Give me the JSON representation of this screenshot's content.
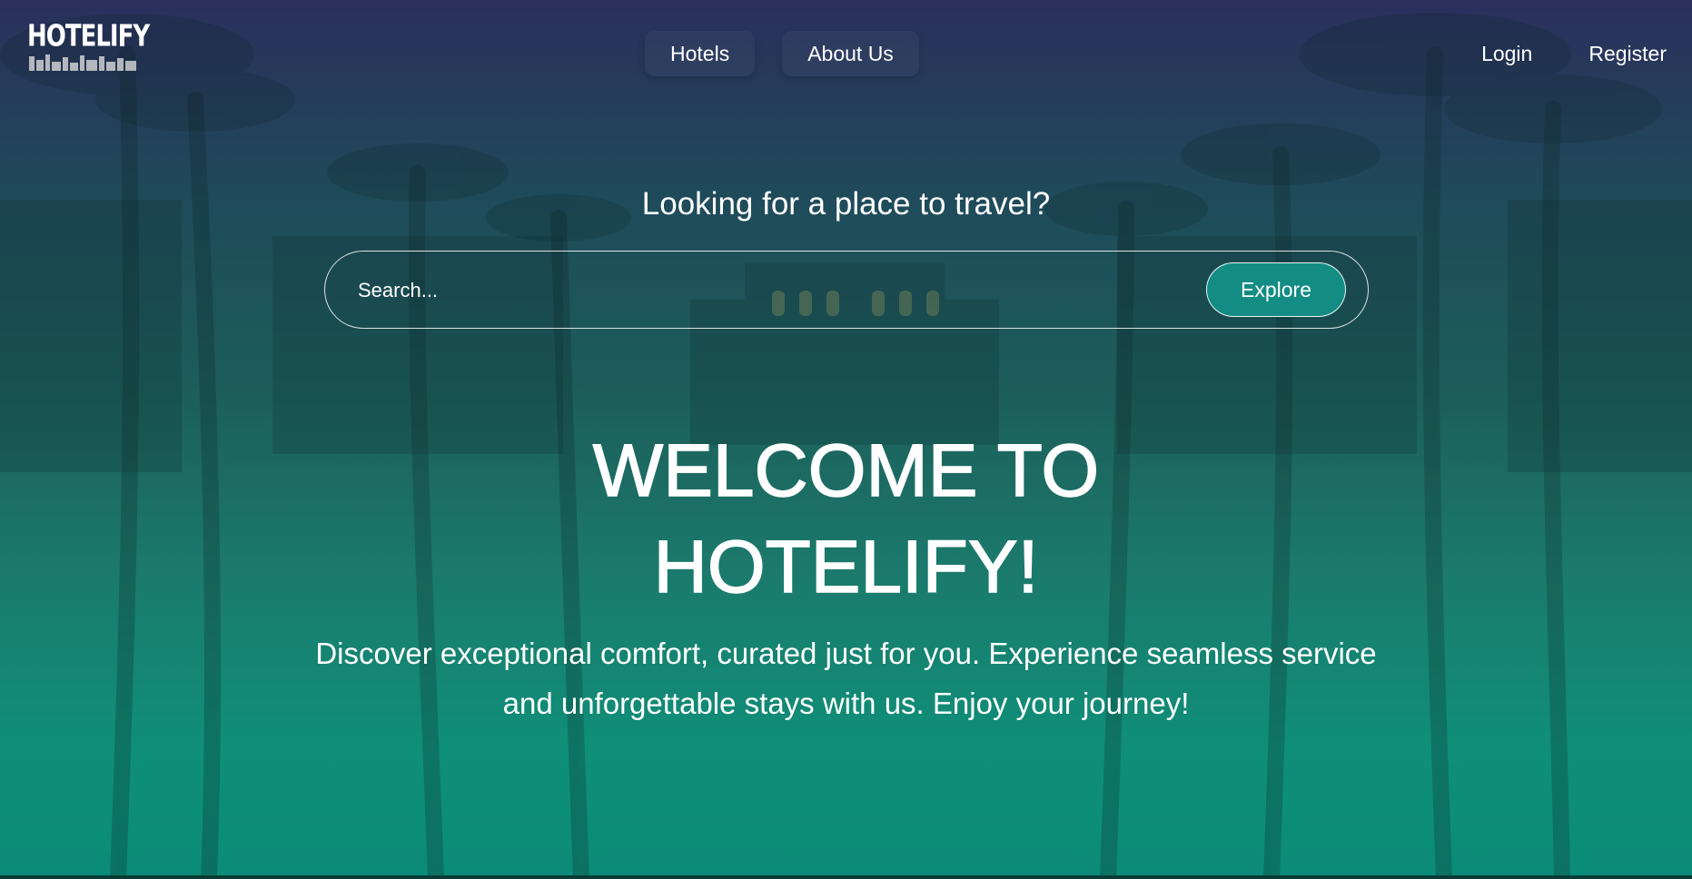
{
  "brand": {
    "logo_text": "HOTELIFY"
  },
  "nav": {
    "center": [
      {
        "label": "Hotels"
      },
      {
        "label": "About Us"
      }
    ],
    "right": [
      {
        "label": "Login"
      },
      {
        "label": "Register"
      }
    ]
  },
  "hero": {
    "tagline": "Looking for a place to travel?",
    "search": {
      "placeholder": "Search...",
      "value": "",
      "button_label": "Explore"
    },
    "title_line1": "WELCOME TO",
    "title_line2": "HOTELIFY!",
    "description": "Discover exceptional comfort, curated just for you. Experience seamless service and unforgettable stays with us. Enjoy your journey!"
  },
  "colors": {
    "accent": "#138d83",
    "gradient_top": "#2b2f5c",
    "gradient_bottom": "#0b8c78",
    "text": "#ffffff"
  }
}
